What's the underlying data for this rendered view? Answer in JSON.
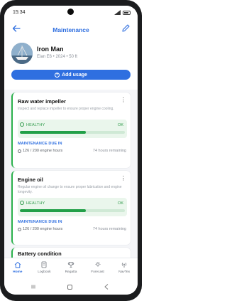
{
  "status_bar": {
    "time": "15:34"
  },
  "app_bar": {
    "title": "Maintenance"
  },
  "boat": {
    "name": "Iron Man",
    "details": "Elan E6 • 2024 • 50 ft"
  },
  "add_usage_label": "Add usage",
  "maintenance_items": [
    {
      "title": "Raw water impeller",
      "description": "Inspect and replace impeller to ensure proper engine cooling.",
      "health_label": "HEALTHY",
      "health_value": "OK",
      "health_fraction": 0.63,
      "due_label": "MAINTENANCE DUE IN",
      "hours": "126 / 200 engine hours",
      "remaining": "74 hours remaining"
    },
    {
      "title": "Engine oil",
      "description": "Regular engine oil change to ensure proper lubrication and engine longevity.",
      "health_label": "HEALTHY",
      "health_value": "OK",
      "health_fraction": 0.63,
      "due_label": "MAINTENANCE DUE IN",
      "hours": "126 / 200 engine hours",
      "remaining": "74 hours remaining"
    },
    {
      "title": "Battery condition"
    }
  ],
  "bottom_nav": [
    {
      "label": "Home",
      "icon": "home-icon",
      "active": true
    },
    {
      "label": "Logbook",
      "icon": "logbook-icon",
      "active": false
    },
    {
      "label": "Regatta",
      "icon": "trophy-icon",
      "active": false
    },
    {
      "label": "Forecast",
      "icon": "weather-icon",
      "active": false
    },
    {
      "label": "NavTex",
      "icon": "radio-icon",
      "active": false
    }
  ],
  "colors": {
    "accent": "#2f6fe0",
    "healthy": "#22a048",
    "healthy_bg": "#eaf6ec"
  }
}
